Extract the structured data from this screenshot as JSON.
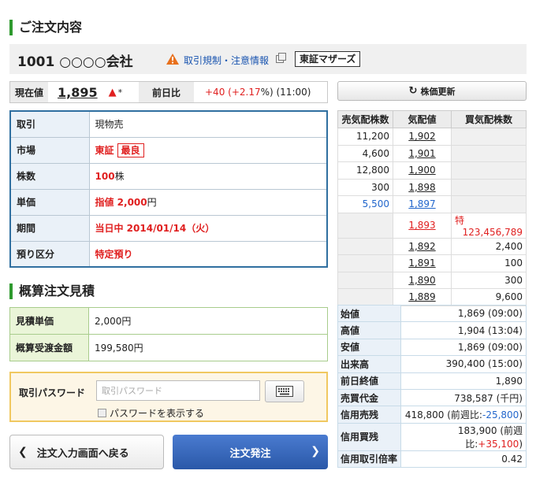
{
  "sections": {
    "order_title": "ご注文内容",
    "estimate_title": "概算注文見積"
  },
  "stock": {
    "name": "1001 ○○○○会社",
    "regulation_link": "取引規制・注意情報",
    "market_tag": "東証マザーズ"
  },
  "price": {
    "current_label": "現在値",
    "current_value": "1,895",
    "up_arrow": "🡅",
    "mark": "*",
    "change_label": "前日比",
    "change_prefix": "+40 (+2.17",
    "change_suffix": "%) (11:00)"
  },
  "order": {
    "rows": [
      {
        "label": "取引",
        "value": "現物売"
      },
      {
        "label": "市場",
        "value": "東証",
        "tag": "最良"
      },
      {
        "label": "株数",
        "value_red": "100",
        "unit": "株"
      },
      {
        "label": "単価",
        "value_red": "指値 2,000",
        "unit": "円"
      },
      {
        "label": "期間",
        "value_red": "当日中 2014/01/14（火）"
      },
      {
        "label": "預り区分",
        "value_red": "特定預り"
      }
    ]
  },
  "estimate": {
    "rows": [
      {
        "label": "見積単価",
        "value": "2,000円"
      },
      {
        "label": "概算受渡金額",
        "value": "199,580円"
      }
    ]
  },
  "password": {
    "label": "取引パスワード",
    "placeholder": "取引パスワード",
    "show_label": "パスワードを表示する"
  },
  "buttons": {
    "back": "注文入力画面へ戻る",
    "submit": "注文発注",
    "refresh": "株価更新"
  },
  "board": {
    "headers": [
      "売気配株数",
      "気配値",
      "買気配株数"
    ],
    "sell_rows": [
      {
        "qty": "11,200",
        "price": "1,902"
      },
      {
        "qty": "4,600",
        "price": "1,901"
      },
      {
        "qty": "12,800",
        "price": "1,900"
      },
      {
        "qty": "300",
        "price": "1,898"
      },
      {
        "qty": "5,500",
        "price": "1,897"
      }
    ],
    "special_row": {
      "price": "1,893",
      "tok": "特",
      "qty": "123,456,789"
    },
    "buy_rows": [
      {
        "price": "1,892",
        "qty": "2,400"
      },
      {
        "price": "1,891",
        "qty": "100"
      },
      {
        "price": "1,890",
        "qty": "300"
      },
      {
        "price": "1,889",
        "qty": "9,600"
      }
    ]
  },
  "info": {
    "rows": [
      {
        "label": "始値",
        "value": "1,869 (09:00)"
      },
      {
        "label": "高値",
        "value": "1,904 (13:04)"
      },
      {
        "label": "安値",
        "value": "1,869 (09:00)"
      },
      {
        "label": "出来高",
        "value": "390,400 (15:00)"
      },
      {
        "label": "前日終値",
        "value": "1,890"
      },
      {
        "label": "売買代金",
        "value": "738,587 (千円)"
      },
      {
        "label": "信用売残",
        "value": "418,800 (前週比:",
        "delta": "-25,800",
        "close": ")"
      },
      {
        "label": "信用買残",
        "value": "183,900 (前週比:",
        "delta": "+35,100",
        "close": ")"
      },
      {
        "label": "信用取引倍率",
        "value": "0.42"
      }
    ]
  },
  "colors": {
    "accent_green": "#2e9a2e",
    "price_up_red": "#e02020",
    "link_blue": "#1a55b0",
    "order_border": "#2f6fa0",
    "submit_blue": "#2a58a8"
  }
}
